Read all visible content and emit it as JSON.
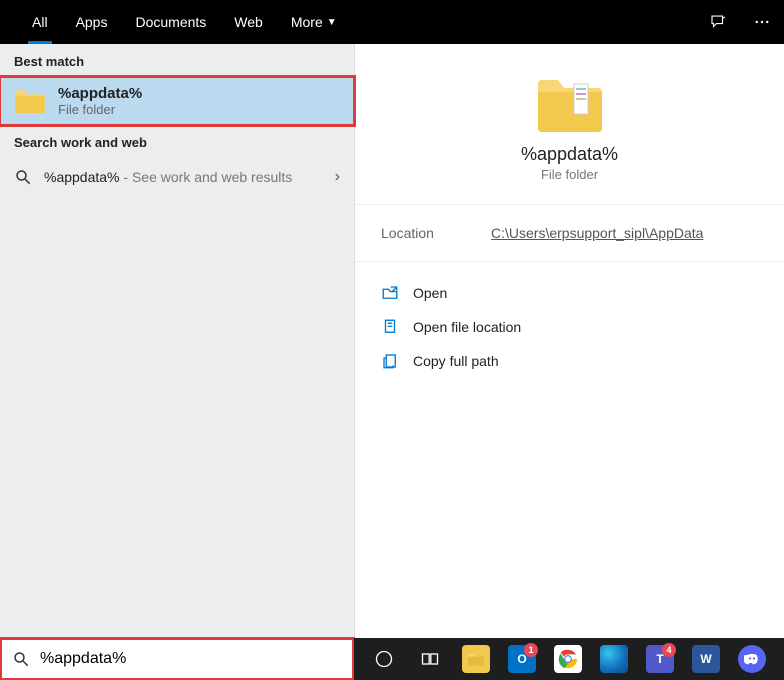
{
  "topbar": {
    "tabs": [
      {
        "label": "All",
        "active": true
      },
      {
        "label": "Apps",
        "active": false
      },
      {
        "label": "Documents",
        "active": false
      },
      {
        "label": "Web",
        "active": false
      },
      {
        "label": "More",
        "active": false,
        "hasDropdown": true
      }
    ]
  },
  "left": {
    "bestMatchHeader": "Best match",
    "bestMatchTitle": "%appdata%",
    "bestMatchSubtitle": "File folder",
    "searchWorkHeader": "Search work and web",
    "webResultLabel": "%appdata%",
    "webResultHint": " - See work and web results"
  },
  "preview": {
    "title": "%appdata%",
    "subtitle": "File folder",
    "locationKey": "Location",
    "locationValue": "C:\\Users\\erpsupport_sipl\\AppData",
    "actions": {
      "open": "Open",
      "openLoc": "Open file location",
      "copyPath": "Copy full path"
    }
  },
  "search": {
    "value": "%appdata%"
  },
  "taskbar": {
    "badges": {
      "outlook": "1",
      "teams": "4"
    }
  }
}
